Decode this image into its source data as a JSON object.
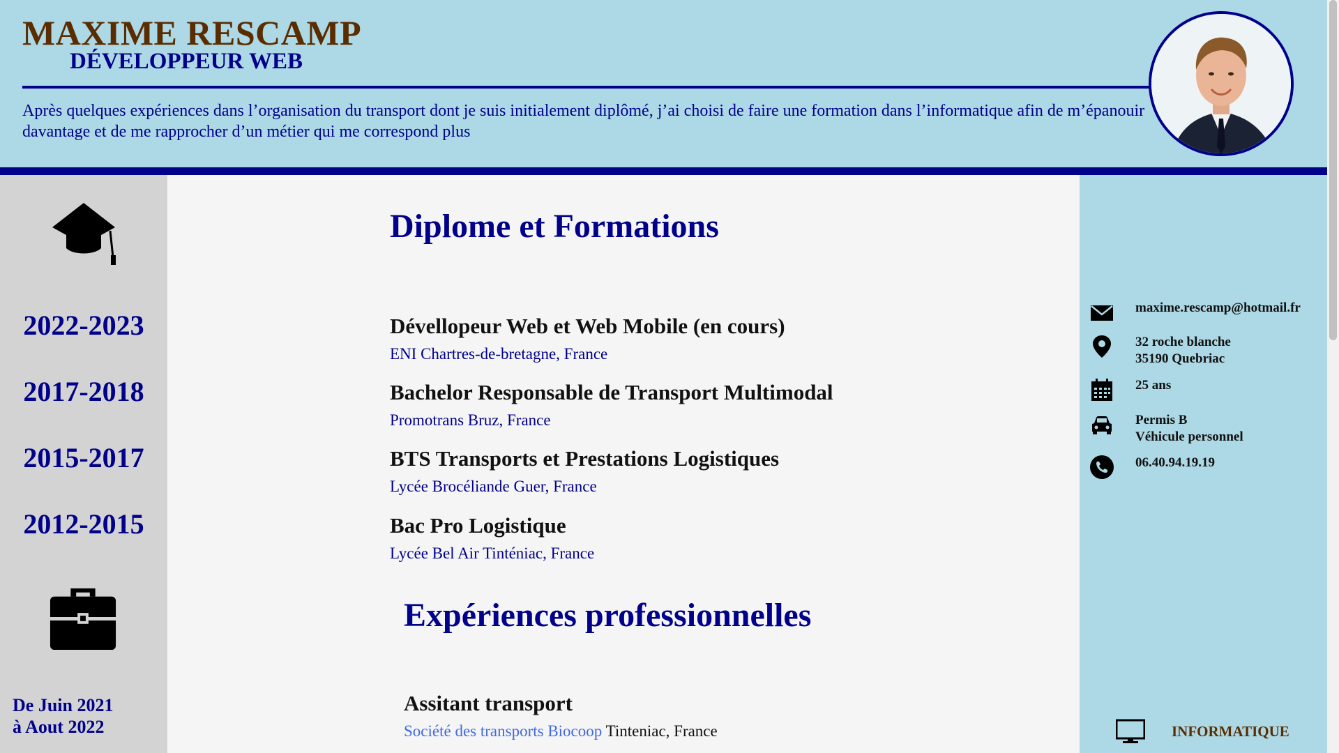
{
  "header": {
    "name": "MAXIME RESCAMP",
    "role": "DÉVELOPPEUR WEB",
    "intro": "Après quelques expériences dans l’organisation du transport dont je suis initialement diplômé, j’ai choisi de faire une formation dans l’informatique afin de m’épanouir davantage et de me rapprocher d’un métier qui me correspond plus"
  },
  "sidebar": {
    "years": [
      "2022-2023",
      "2017-2018",
      "2015-2017",
      "2012-2015"
    ],
    "date_range_line1": "De Juin 2021",
    "date_range_line2": "à Aout 2022"
  },
  "education": {
    "title": "Diplome et Formations",
    "items": [
      {
        "title": "Dévellopeur Web et Web Mobile (en cours)",
        "place": "ENI Chartres-de-bretagne, France"
      },
      {
        "title": "Bachelor Responsable de Transport Multimodal",
        "place": "Promotrans Bruz, France"
      },
      {
        "title": "BTS Transports et Prestations Logistiques",
        "place": "Lycée Brocéliande Guer, France"
      },
      {
        "title": "Bac Pro Logistique",
        "place": "Lycée Bel Air Tinténiac, France"
      }
    ]
  },
  "experience": {
    "title": "Expériences professionnelles",
    "items": [
      {
        "title": "Assitant transport",
        "company": "Société des transports Biocoop",
        "location": "Tinteniac, France"
      }
    ]
  },
  "contact": {
    "email": "maxime.rescamp@hotmail.fr",
    "address_line1": "32 roche blanche",
    "address_line2": "35190 Quebriac",
    "age": "25 ans",
    "license_line1": "Permis B",
    "license_line2": "Véhicule personnel",
    "phone": "06.40.94.19.19"
  },
  "skills": {
    "category": "INFORMATIQUE"
  },
  "icons": {
    "header_photo": "avatar-photo",
    "education": "graduation-cap-icon",
    "experience": "briefcase-icon",
    "email": "envelope-icon",
    "address": "map-pin-icon",
    "age": "calendar-icon",
    "license": "car-icon",
    "phone": "phone-icon",
    "skills": "monitor-icon"
  },
  "colors": {
    "header_bg": "#add8e6",
    "accent": "#00008b",
    "name": "#5a2d00",
    "sidebar_bg": "#d3d3d3",
    "link": "#4169e1"
  }
}
